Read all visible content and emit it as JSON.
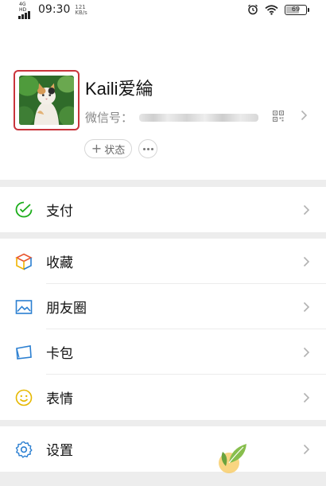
{
  "status_bar": {
    "network": "4G HD",
    "time": "09:30",
    "speed_value": "121",
    "speed_unit": "KB/s",
    "battery": "69",
    "battery_level": 0.69,
    "icons": [
      "alarm-icon",
      "wifi-icon",
      "battery-icon"
    ]
  },
  "profile": {
    "name": "Kaili爱綸",
    "wechat_id_label": "微信号：",
    "status_label": "状态",
    "icons": [
      "avatar",
      "qr-code-icon",
      "chevron-right-icon",
      "more-icon"
    ]
  },
  "menu": {
    "pay": {
      "label": "支付",
      "icon": "pay-icon"
    },
    "favorites": {
      "label": "收藏",
      "icon": "favorites-cube-icon"
    },
    "moments": {
      "label": "朋友圈",
      "icon": "moments-photo-icon"
    },
    "cards": {
      "label": "卡包",
      "icon": "card-wallet-icon"
    },
    "stickers": {
      "label": "表情",
      "icon": "sticker-smile-icon"
    },
    "settings": {
      "label": "设置",
      "icon": "settings-gear-icon"
    }
  },
  "colors": {
    "avatar_border": "#c9343b",
    "pay_green": "#1aad19",
    "icon_blue": "#2b7fd1",
    "sticker_yellow": "#e6b800",
    "background": "#ededed"
  }
}
